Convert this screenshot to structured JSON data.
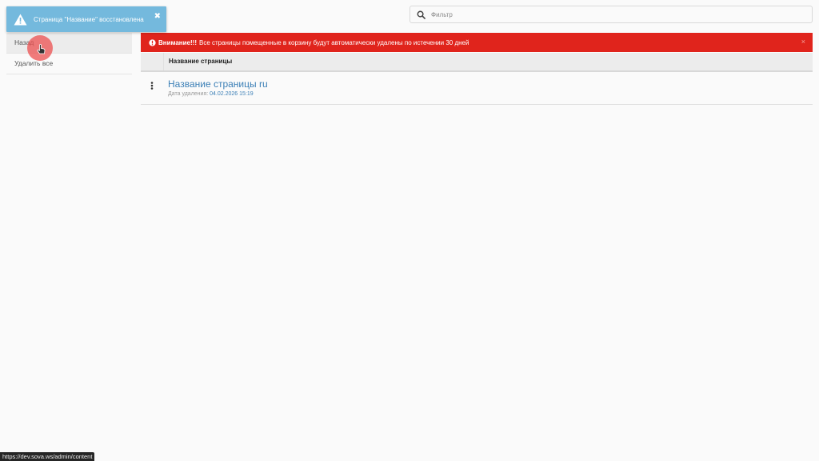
{
  "toast": {
    "icon": "warning-triangle-icon",
    "message": "Страница \"Название\" восстановлена",
    "close": "✖"
  },
  "search": {
    "icon": "search-icon",
    "placeholder": "Фильтр"
  },
  "sidebar": {
    "items": [
      {
        "label": "Назад"
      },
      {
        "label": "Удалить все"
      }
    ]
  },
  "alert": {
    "icon": "exclamation-circle-icon",
    "strong": "Внимание!!!",
    "text": "Все страницы помещенные в корзину будут автоматически удалены по истечении 30 дней",
    "close": "×",
    "color": "#e0241c"
  },
  "table": {
    "header": {
      "name": "Название страницы"
    },
    "rows": [
      {
        "title": "Название страницы ru",
        "date_label": "Дата удаления:",
        "date": "04.02.2026 15:19"
      }
    ]
  },
  "status_url": "https://dev.sova.ws/admin/content",
  "colors": {
    "accent": "#3b7fb6",
    "toast": "#74b9dd",
    "alert": "#e0241c"
  }
}
